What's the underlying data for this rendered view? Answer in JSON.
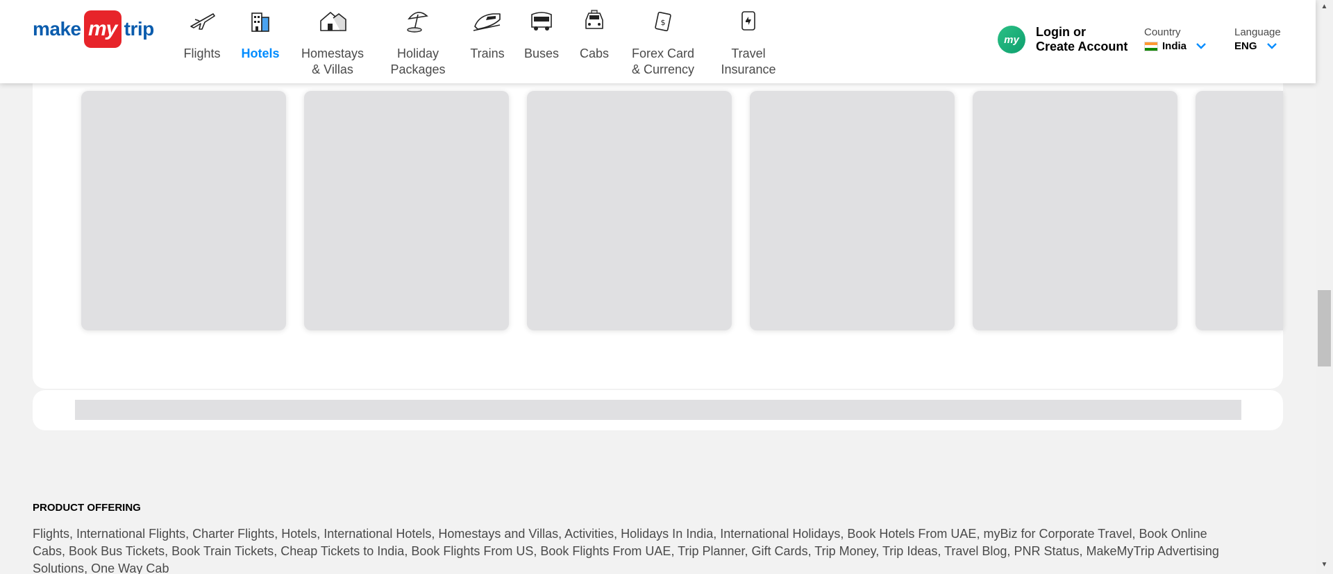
{
  "header": {
    "logo": {
      "make": "make",
      "my": "my",
      "trip": "trip"
    },
    "nav": [
      {
        "label": "Flights",
        "icon": "airplane-icon",
        "active": false
      },
      {
        "label": "Hotels",
        "icon": "hotel-building-icon",
        "active": true
      },
      {
        "label": "Homestays\n& Villas",
        "icon": "house-icon",
        "active": false
      },
      {
        "label": "Holiday\nPackages",
        "icon": "beach-umbrella-icon",
        "active": false
      },
      {
        "label": "Trains",
        "icon": "train-icon",
        "active": false
      },
      {
        "label": "Buses",
        "icon": "bus-icon",
        "active": false
      },
      {
        "label": "Cabs",
        "icon": "cab-icon",
        "active": false
      },
      {
        "label": "Forex Card\n& Currency",
        "icon": "forex-icon",
        "active": false
      },
      {
        "label": "Travel\nInsurance",
        "icon": "insurance-icon",
        "active": false
      }
    ],
    "login": {
      "avatar_text": "my",
      "label": "Login or\nCreate Account"
    },
    "country": {
      "caption": "Country",
      "value": "India"
    },
    "language": {
      "caption": "Language",
      "value": "ENG"
    }
  },
  "footer": {
    "product_offering_title": "PRODUCT OFFERING",
    "links": [
      "Flights",
      "International Flights",
      "Charter Flights",
      "Hotels",
      "International Hotels",
      "Homestays and Villas",
      "Activities",
      "Holidays In India",
      "International Holidays",
      "Book Hotels From UAE",
      "myBiz for Corporate Travel",
      "Book Online Cabs",
      "Book Bus Tickets",
      "Book Train Tickets",
      "Cheap Tickets to India",
      "Book Flights From US",
      "Book Flights From UAE",
      "Trip Planner",
      "Gift Cards",
      "Trip Money",
      "Trip Ideas",
      "Travel Blog",
      "PNR Status",
      "MakeMyTrip Advertising Solutions",
      "One Way Cab"
    ]
  },
  "colors": {
    "brand_blue": "#0b5cad",
    "brand_red": "#e7242a",
    "active_blue": "#008cff",
    "placeholder": "#e0e0e2"
  }
}
